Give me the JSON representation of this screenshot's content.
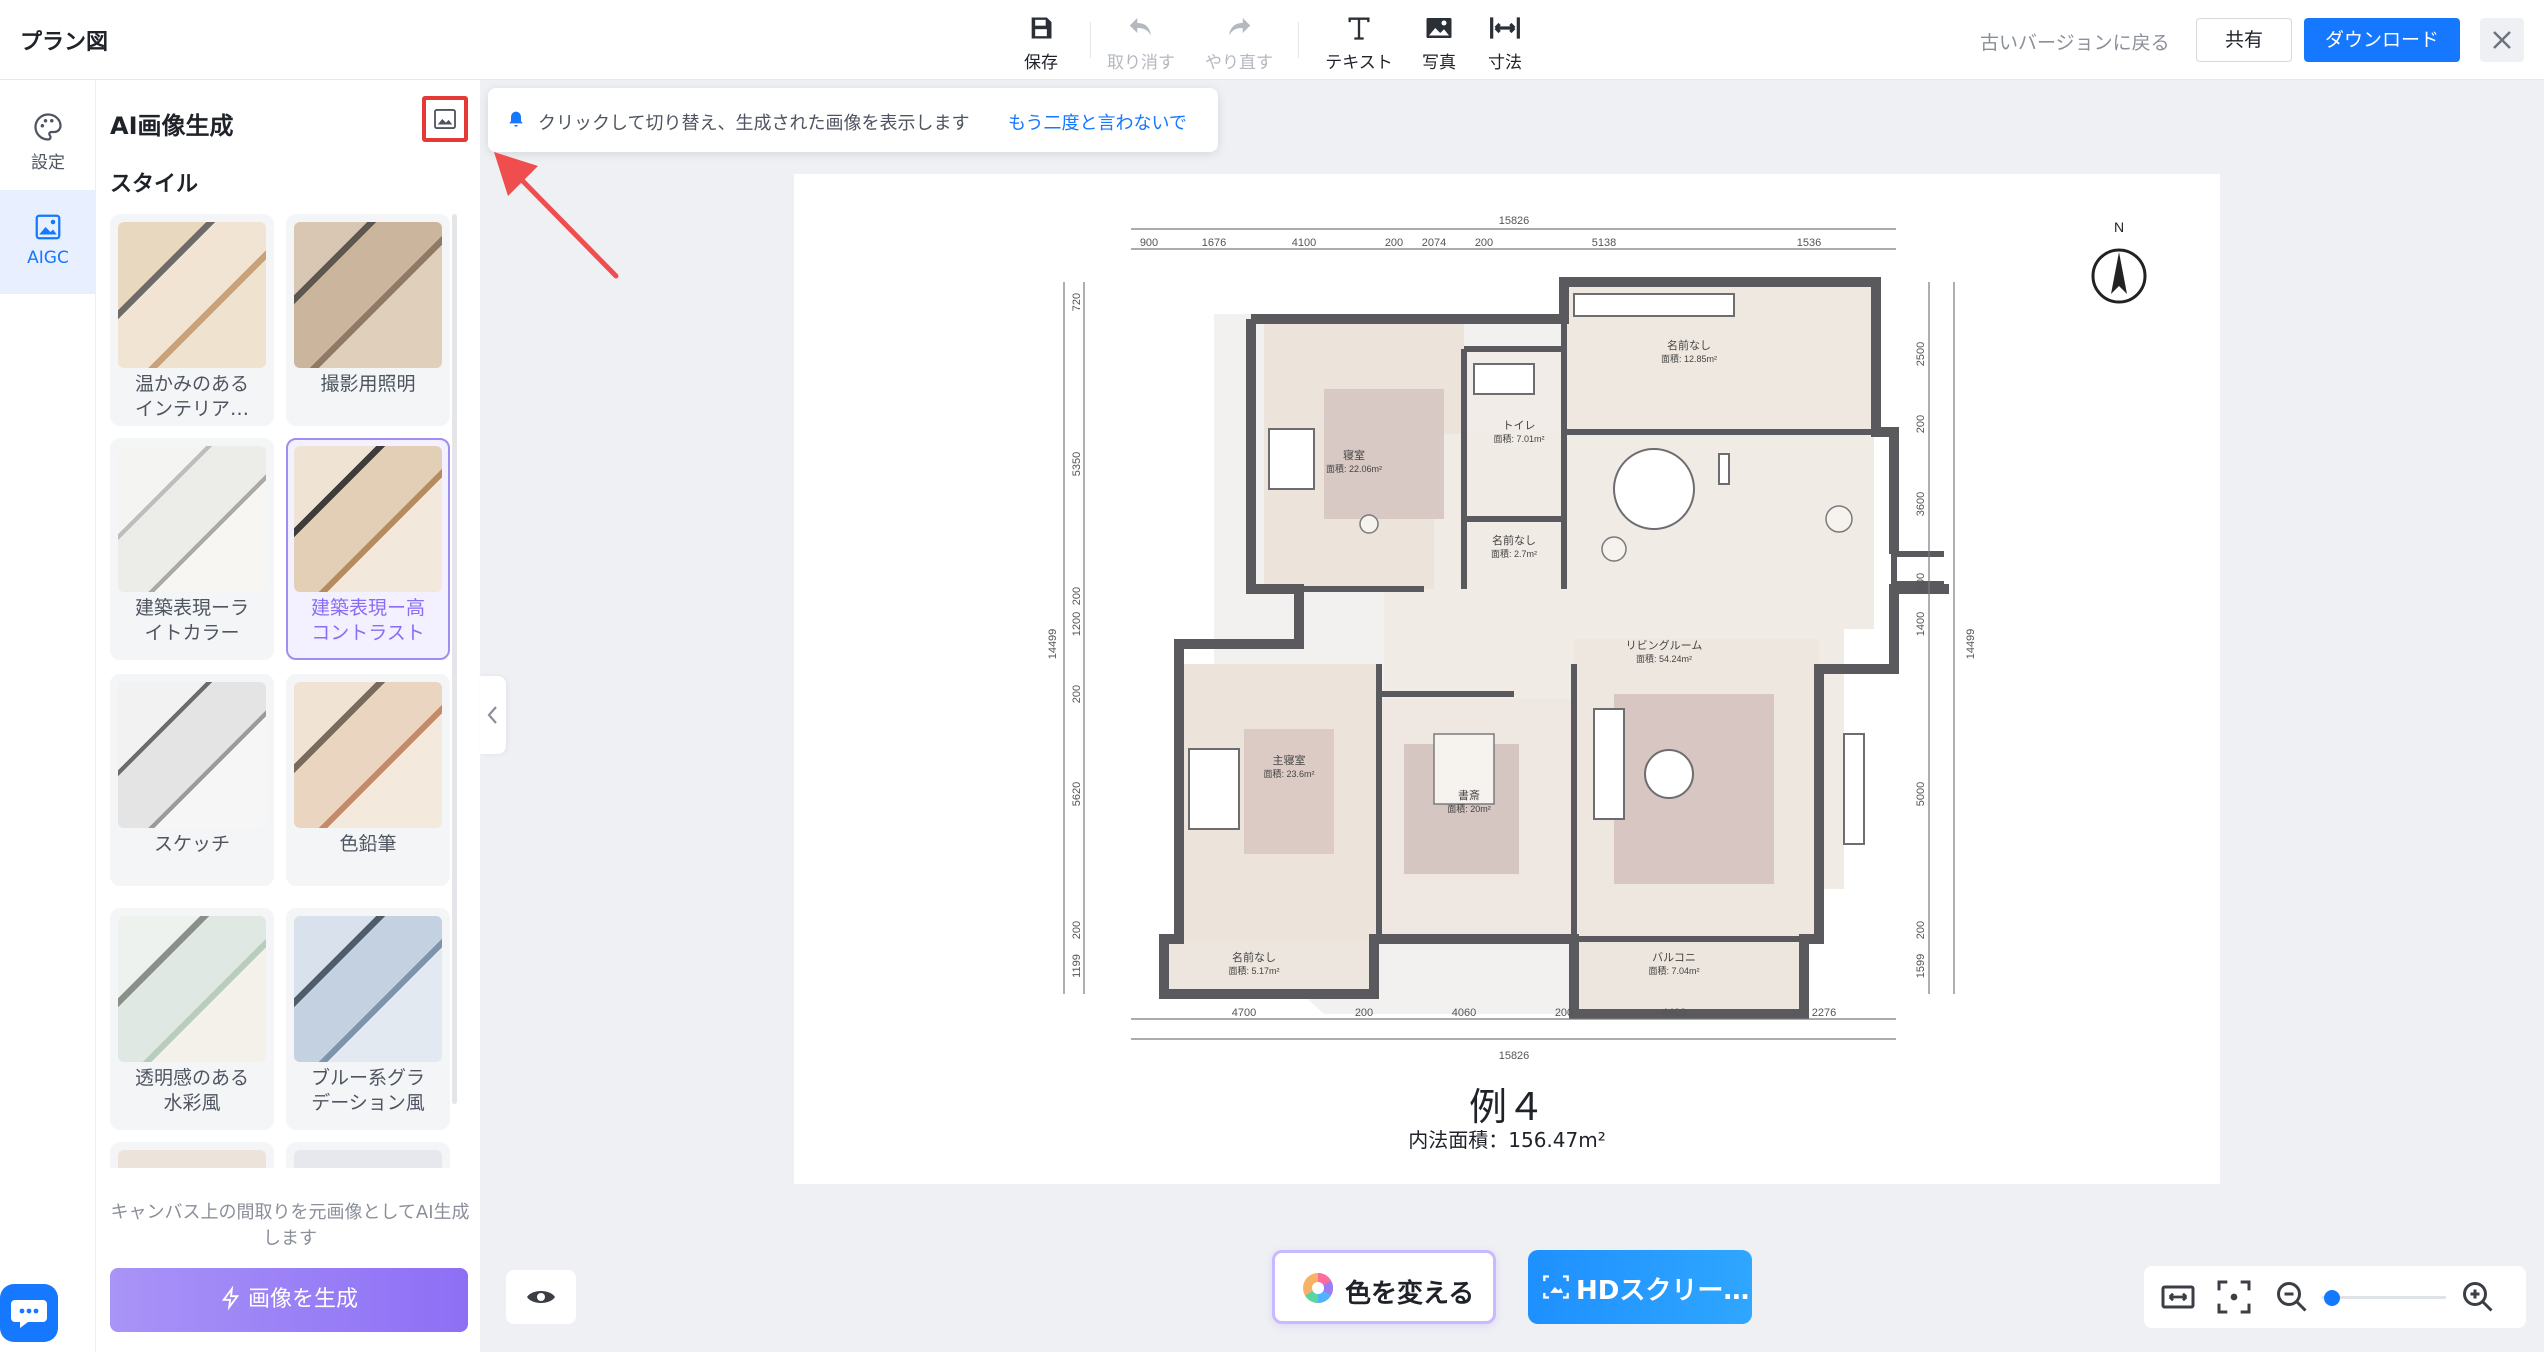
{
  "app": {
    "title": "プラン図"
  },
  "toolbar": {
    "save": "保存",
    "undo": "取り消す",
    "redo": "やり直す",
    "text": "テキスト",
    "photo": "写真",
    "dimension": "寸法"
  },
  "header_right": {
    "back_to_old": "古いバージョンに戻る",
    "share": "共有",
    "download": "ダウンロード"
  },
  "rail": {
    "items": [
      {
        "label": "設定",
        "icon": "palette-icon",
        "active": false
      },
      {
        "label": "AIGC",
        "icon": "image-ai-icon",
        "active": true
      }
    ]
  },
  "panel": {
    "title": "AI画像生成",
    "section": "スタイル",
    "styles": [
      {
        "label": "温かみのある\nインテリア…",
        "selected": false
      },
      {
        "label": "撮影用照明",
        "selected": false
      },
      {
        "label": "建築表現ーラ\nイトカラー",
        "selected": false
      },
      {
        "label": "建築表現ー高\nコントラスト",
        "selected": true
      },
      {
        "label": "スケッチ",
        "selected": false
      },
      {
        "label": "色鉛筆",
        "selected": false
      },
      {
        "label": "透明感のある\n水彩風",
        "selected": false
      },
      {
        "label": "ブルー系グラ\nデーション風",
        "selected": false
      }
    ],
    "hint": "キャンバス上の間取りを元画像としてAI生成します",
    "generate": "画像を生成"
  },
  "tooltip": {
    "text": "クリックして切り替え、生成された画像を表示します",
    "link": "もう二度と言わないで"
  },
  "plan": {
    "title": "例４",
    "area": "内法面積：156.47m²",
    "north": "N",
    "total_width": "15826",
    "total_height": "14499",
    "top_dims": [
      "900",
      "1676",
      "4100",
      "200",
      "2074",
      "200",
      "5138",
      "1536"
    ],
    "bottom_dims": [
      "4700",
      "200",
      "4060",
      "200",
      "4400",
      "2276"
    ],
    "left_dims": [
      "720",
      "5350",
      "200",
      "1200",
      "200",
      "5620",
      "200",
      "1199"
    ],
    "right_dims": [
      "2500",
      "200",
      "3600",
      "200",
      "1400",
      "5000",
      "200",
      "1599"
    ],
    "rooms": [
      {
        "name": "名前なし",
        "area": "面積: 12.85m²"
      },
      {
        "name": "トイレ",
        "area": "面積: 7.01m²"
      },
      {
        "name": "寝室",
        "area": "面積: 22.06m²"
      },
      {
        "name": "名前なし",
        "area": "面積: 2.7m²"
      },
      {
        "name": "リビングルーム",
        "area": "面積: 54.24m²"
      },
      {
        "name": "主寝室",
        "area": "面積: 23.6m²"
      },
      {
        "name": "書斎",
        "area": "面積: 20m²"
      },
      {
        "name": "名前なし",
        "area": "面積: 5.17m²"
      },
      {
        "name": "バルコニ",
        "area": "面積: 7.04m²"
      }
    ]
  },
  "bottom": {
    "change_color": "色を変える",
    "hd_screenshot": "HDスクリー…"
  },
  "colors": {
    "accent": "#1677ff",
    "purple": "#8d6ff5",
    "highlight": "#e53935"
  }
}
